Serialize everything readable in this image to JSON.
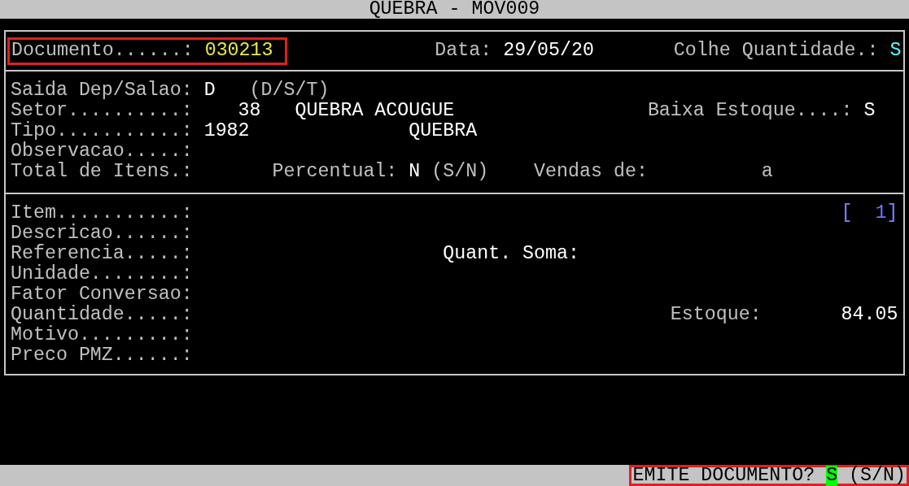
{
  "window": {
    "title": "QUEBRA - MOV009"
  },
  "header": {
    "highlighted": true,
    "document_label": "Documento......:",
    "document_value": "030213",
    "date_label": "Data:",
    "date_value": "29/05/20",
    "collect_label": "Colhe Quantidade.:",
    "collect_value": "S"
  },
  "details": {
    "saida": {
      "label": "Saida Dep/Salao:",
      "value": "D",
      "hint": "(D/S/T)"
    },
    "setor": {
      "label": "Setor..........:",
      "code": "38",
      "name": "QUEBRA ACOUGUE"
    },
    "baixa": {
      "label": "Baixa Estoque....:",
      "value": "S"
    },
    "tipo": {
      "label": "Tipo...........:",
      "code": "1982",
      "name": "QUEBRA"
    },
    "observacao": {
      "label": "Observacao.....:"
    },
    "total": {
      "label": "Total de Itens.:"
    },
    "percentual": {
      "label": "Percentual:",
      "value": "N",
      "hint": "(S/N)"
    },
    "vendas": {
      "label": "Vendas de:",
      "separator": "a"
    }
  },
  "item": {
    "labels": [
      "Item...........:",
      "Descricao......:",
      "Referencia.....:",
      "Unidade........:",
      "Fator Conversao:",
      "Quantidade.....:",
      "Motivo.........:",
      "Preco PMZ......:"
    ],
    "counter": {
      "open": "[",
      "number": "1",
      "close": "]"
    },
    "quant_soma_label": "Quant. Soma:",
    "estoque_label": "Estoque:",
    "estoque_value": "84.05"
  },
  "prompt": {
    "highlighted": true,
    "question": "EMITE DOCUMENTO?",
    "answer": "S",
    "hint": "(S/N)"
  }
}
